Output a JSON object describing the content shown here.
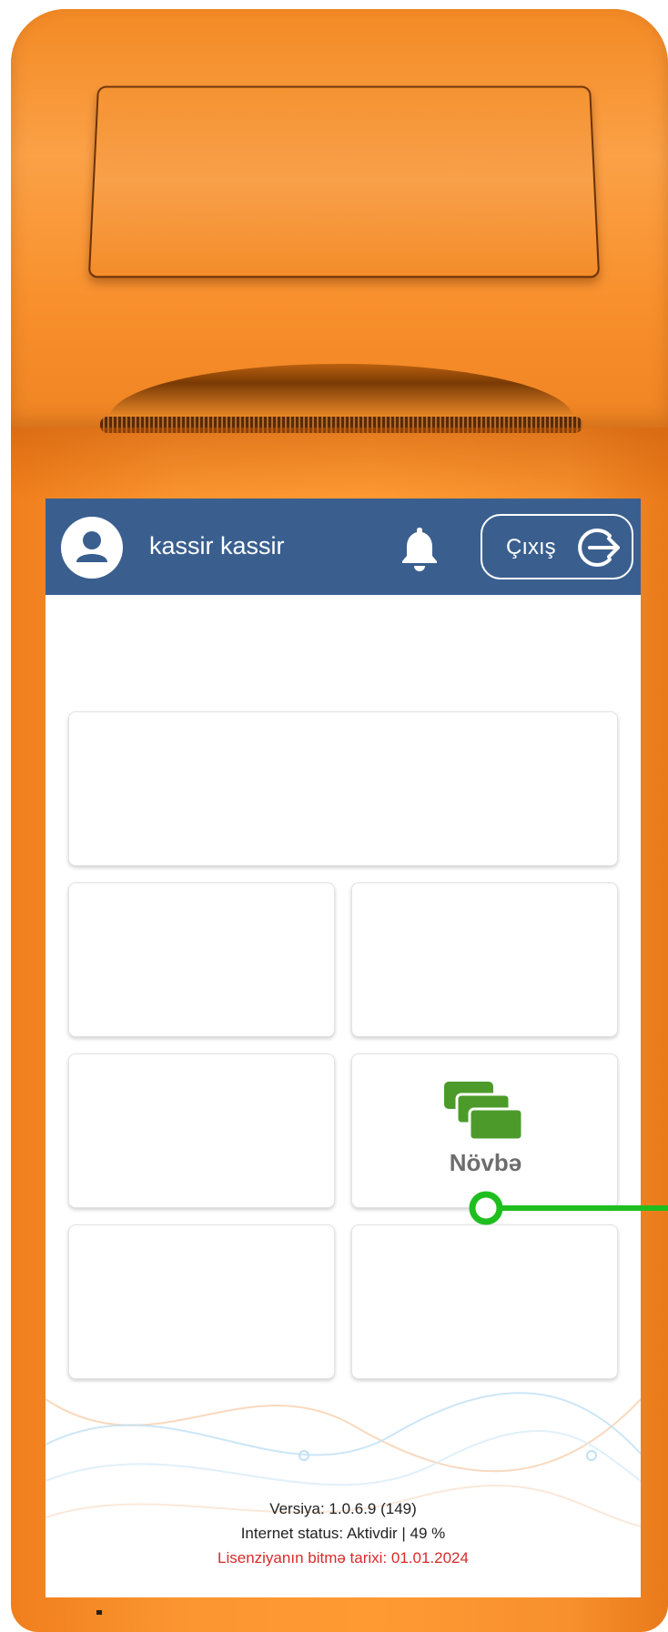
{
  "header": {
    "user_name": "kassir kassir",
    "logout_label": "Çıxış"
  },
  "tiles": {
    "shift_label": "Növbə"
  },
  "footer": {
    "version": "Versiya: 1.0.6.9 (149)",
    "internet_status": "Internet status: Aktivdir | 49 %",
    "license_expiry": "Lisenziyanın bitmə tarixi: 01.01.2024"
  },
  "icons": {
    "avatar": "user-avatar-icon",
    "bell": "bell-icon",
    "logout": "logout-icon",
    "shift": "shift-cards-icon"
  },
  "colors": {
    "header": "#3a5f8f",
    "device": "#ff9a33",
    "shift_icon": "#4c9b2a",
    "license_text": "#d92b2b",
    "marker": "#1fbe1f"
  }
}
